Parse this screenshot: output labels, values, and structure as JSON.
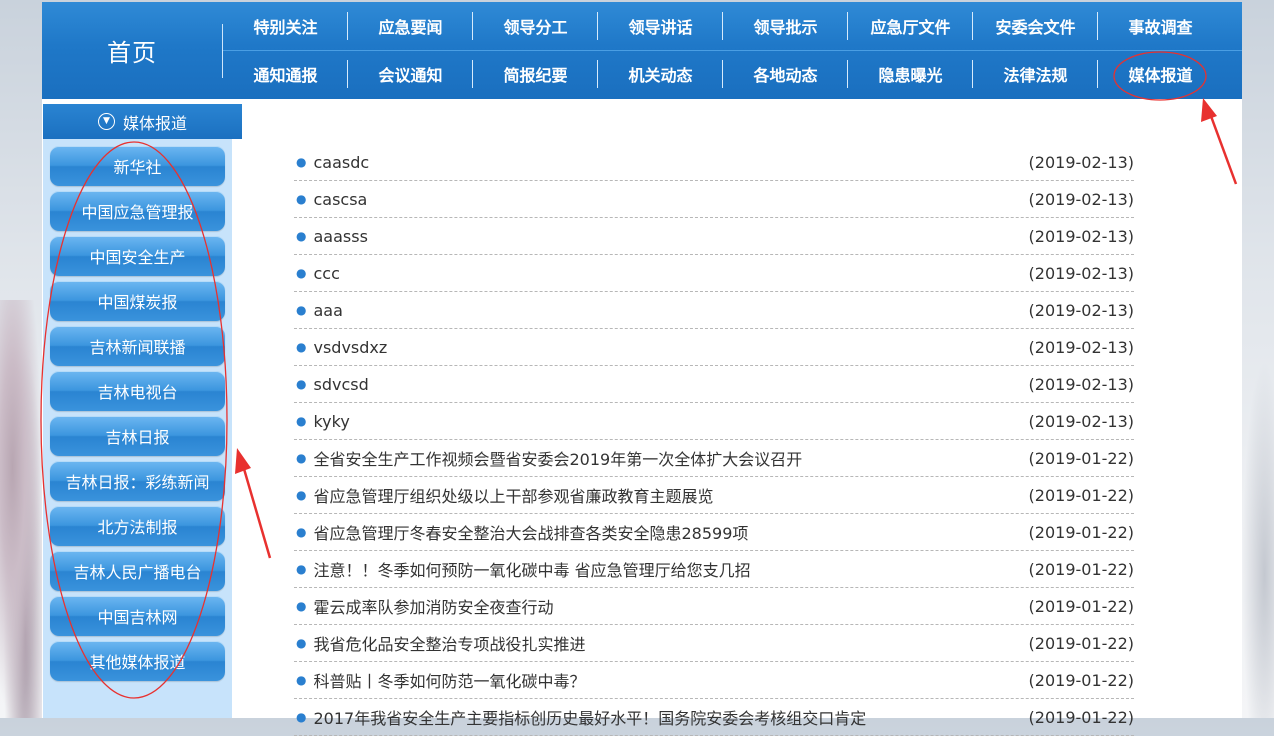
{
  "topnav": {
    "home_label": "首页",
    "row1": [
      "特别关注",
      "应急要闻",
      "领导分工",
      "领导讲话",
      "领导批示",
      "应急厅文件",
      "安委会文件",
      "事故调查"
    ],
    "row2": [
      "通知通报",
      "会议通知",
      "简报纪要",
      "机关动态",
      "各地动态",
      "隐患曝光",
      "法律法规",
      "媒体报道"
    ]
  },
  "sidebar": {
    "title": "媒体报道",
    "items": [
      "新华社",
      "中国应急管理报",
      "中国安全生产",
      "中国煤炭报",
      "吉林新闻联播",
      "吉林电视台",
      "吉林日报",
      "吉林日报：彩练新闻",
      "北方法制报",
      "吉林人民广播电台",
      "中国吉林网",
      "其他媒体报道"
    ]
  },
  "articles": [
    {
      "title": "caasdc",
      "date": "(2019-02-13)"
    },
    {
      "title": "cascsa",
      "date": "(2019-02-13)"
    },
    {
      "title": "aaasss",
      "date": "(2019-02-13)"
    },
    {
      "title": "ccc",
      "date": "(2019-02-13)"
    },
    {
      "title": "aaa",
      "date": "(2019-02-13)"
    },
    {
      "title": "vsdvsdxz",
      "date": "(2019-02-13)"
    },
    {
      "title": "sdvcsd",
      "date": "(2019-02-13)"
    },
    {
      "title": "kyky",
      "date": "(2019-02-13)"
    },
    {
      "title": "全省安全生产工作视频会暨省安委会2019年第一次全体扩大会议召开",
      "date": "(2019-01-22)"
    },
    {
      "title": "省应急管理厅组织处级以上干部参观省廉政教育主题展览",
      "date": "(2019-01-22)"
    },
    {
      "title": "省应急管理厅冬春安全整治大会战排查各类安全隐患28599项",
      "date": "(2019-01-22)"
    },
    {
      "title": "注意！！冬季如何预防一氧化碳中毒 省应急管理厅给您支几招",
      "date": "(2019-01-22)"
    },
    {
      "title": "霍云成率队参加消防安全夜查行动",
      "date": "(2019-01-22)"
    },
    {
      "title": "我省危化品安全整治专项战役扎实推进",
      "date": "(2019-01-22)"
    },
    {
      "title": "科普贴丨冬季如何防范一氧化碳中毒？",
      "date": "(2019-01-22)"
    },
    {
      "title": "2017年我省安全生产主要指标创历史最好水平！国务院安委会考核组交口肯定",
      "date": "(2019-01-22)"
    }
  ],
  "colors": {
    "nav_blue": "#1f78c8",
    "sidebar_bg": "#c7e3fb",
    "annotation_red": "#e8312f"
  }
}
